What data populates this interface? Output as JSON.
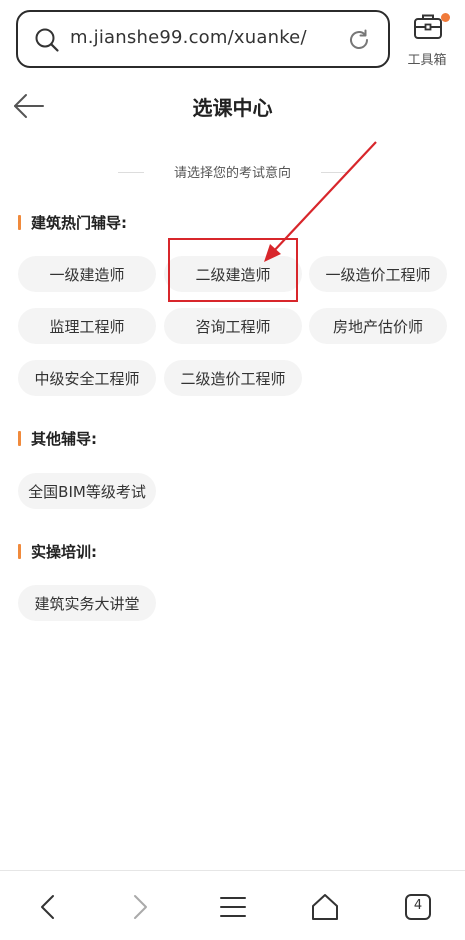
{
  "browser": {
    "url": "m.jianshe99.com/xuanke/",
    "toolbox_label": "工具箱"
  },
  "header": {
    "title": "选课中心"
  },
  "subtitle": "请选择您的考试意向",
  "sections": [
    {
      "title": "建筑热门辅导:",
      "chips": [
        "一级建造师",
        "二级建造师",
        "一级造价工程师",
        "监理工程师",
        "咨询工程师",
        "房地产估价师",
        "中级安全工程师",
        "二级造价工程师"
      ]
    },
    {
      "title": "其他辅导:",
      "chips": [
        "全国BIM等级考试"
      ]
    },
    {
      "title": "实操培训:",
      "chips": [
        "建筑实务大讲堂"
      ]
    }
  ],
  "bottom_nav": {
    "tab_count": "4"
  },
  "colors": {
    "accent": "#f08a3c",
    "highlight": "#d8262b",
    "notification_dot": "#f07a3a"
  }
}
